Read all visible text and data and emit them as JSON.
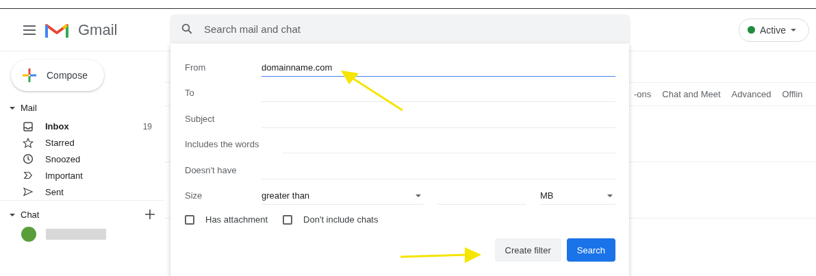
{
  "app": {
    "name": "Gmail"
  },
  "compose": {
    "label": "Compose"
  },
  "search": {
    "placeholder": "Search mail and chat"
  },
  "status": {
    "label": "Active",
    "color": "#1e8e3e"
  },
  "mail_section": {
    "label": "Mail",
    "expanded": true
  },
  "folders": [
    {
      "kind": "inbox",
      "label": "Inbox",
      "count": "19",
      "selected": true
    },
    {
      "kind": "star",
      "label": "Starred",
      "selected": false
    },
    {
      "kind": "clock",
      "label": "Snoozed",
      "selected": false
    },
    {
      "kind": "important",
      "label": "Important",
      "selected": false
    },
    {
      "kind": "send",
      "label": "Sent",
      "selected": false
    }
  ],
  "chat_section": {
    "label": "Chat",
    "expanded": true
  },
  "settings_tabs": [
    "-ons",
    "Chat and Meet",
    "Advanced",
    "Offlin"
  ],
  "search_options": {
    "fields": [
      {
        "kind": "text",
        "label": "From",
        "value": "domainname.com",
        "focused": true
      },
      {
        "kind": "text",
        "label": "To",
        "focused": false
      },
      {
        "kind": "text",
        "label": "Subject",
        "focused": false
      },
      {
        "kind": "text",
        "label": "Includes the words",
        "focused": false
      },
      {
        "kind": "text",
        "label": "Doesn't have",
        "focused": false
      },
      {
        "kind": "size",
        "label": "Size",
        "operator": "greater than",
        "unit": "MB"
      }
    ],
    "checkboxes": [
      {
        "label": "Has attachment",
        "checked": false
      },
      {
        "label": "Don't include chats",
        "checked": false
      }
    ],
    "buttons": [
      {
        "label": "Create filter",
        "kind": "secondary"
      },
      {
        "label": "Search",
        "kind": "primary"
      }
    ]
  }
}
